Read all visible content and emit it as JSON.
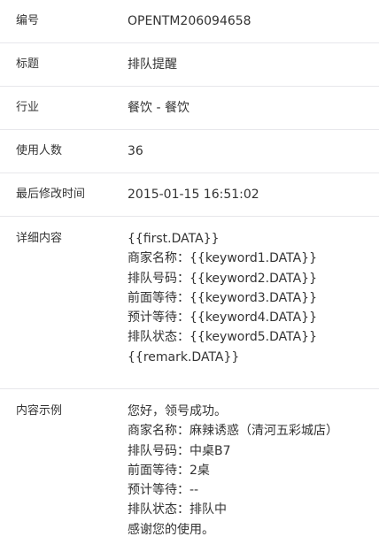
{
  "fields": {
    "id": {
      "label": "编号",
      "value": "OPENTM206094658"
    },
    "title": {
      "label": "标题",
      "value": "排队提醒"
    },
    "industry": {
      "label": "行业",
      "value": "餐饮 - 餐饮"
    },
    "users": {
      "label": "使用人数",
      "value": "36"
    },
    "modified": {
      "label": "最后修改时间",
      "value": "2015-01-15 16:51:02"
    }
  },
  "detail": {
    "label": "详细内容",
    "lines": [
      "{{first.DATA}}",
      "商家名称：{{keyword1.DATA}}",
      "排队号码：{{keyword2.DATA}}",
      "前面等待：{{keyword3.DATA}}",
      "预计等待：{{keyword4.DATA}}",
      "排队状态：{{keyword5.DATA}}",
      "{{remark.DATA}}"
    ]
  },
  "example": {
    "label": "内容示例",
    "lines": [
      "您好，领号成功。",
      "商家名称：麻辣诱惑（清河五彩城店）",
      "排队号码：中桌B7",
      "前面等待：2桌",
      "预计等待：--",
      "排队状态：排队中",
      "感谢您的使用。"
    ]
  }
}
